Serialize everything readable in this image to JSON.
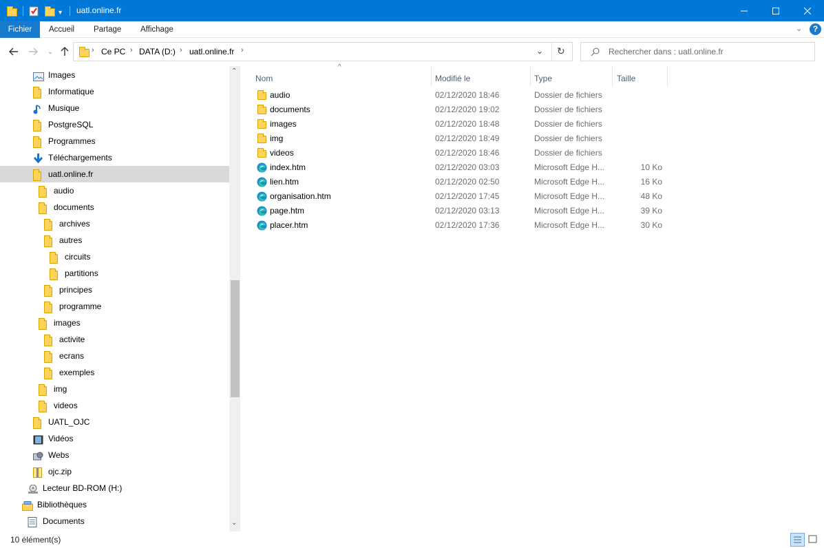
{
  "window": {
    "title": "uatl.online.fr"
  },
  "ribbon": {
    "tabs": [
      "Fichier",
      "Accueil",
      "Partage",
      "Affichage"
    ]
  },
  "address": {
    "crumbs": [
      "Ce PC",
      "DATA (D:)",
      "uatl.online.fr"
    ],
    "search_placeholder": "Rechercher dans : uatl.online.fr"
  },
  "nav": {
    "items": [
      {
        "label": "Images",
        "icon": "pictures-icon",
        "indent": 0
      },
      {
        "label": "Informatique",
        "icon": "folder-icon",
        "indent": 0
      },
      {
        "label": "Musique",
        "icon": "music-icon",
        "indent": 0
      },
      {
        "label": "PostgreSQL",
        "icon": "folder-icon",
        "indent": 0
      },
      {
        "label": "Programmes",
        "icon": "folder-icon",
        "indent": 0
      },
      {
        "label": "Téléchargements",
        "icon": "download-icon",
        "indent": 0
      },
      {
        "label": "uatl.online.fr",
        "icon": "folder-icon",
        "indent": 0,
        "selected": true
      },
      {
        "label": "audio",
        "icon": "folder-icon",
        "indent": 1
      },
      {
        "label": "documents",
        "icon": "folder-icon",
        "indent": 1
      },
      {
        "label": "archives",
        "icon": "folder-icon",
        "indent": 2
      },
      {
        "label": "autres",
        "icon": "folder-icon",
        "indent": 2
      },
      {
        "label": "circuits",
        "icon": "folder-icon",
        "indent": 3
      },
      {
        "label": "partitions",
        "icon": "folder-icon",
        "indent": 3
      },
      {
        "label": "principes",
        "icon": "folder-icon",
        "indent": 2
      },
      {
        "label": "programme",
        "icon": "folder-icon",
        "indent": 2
      },
      {
        "label": "images",
        "icon": "folder-icon",
        "indent": 1
      },
      {
        "label": "activite",
        "icon": "folder-icon",
        "indent": 2
      },
      {
        "label": "ecrans",
        "icon": "folder-icon",
        "indent": 2
      },
      {
        "label": "exemples",
        "icon": "folder-icon",
        "indent": 2
      },
      {
        "label": "img",
        "icon": "folder-icon",
        "indent": 1
      },
      {
        "label": "videos",
        "icon": "folder-icon",
        "indent": 1
      },
      {
        "label": "UATL_OJC",
        "icon": "folder-icon",
        "indent": 0
      },
      {
        "label": "Vidéos",
        "icon": "video-icon",
        "indent": 0
      },
      {
        "label": "Webs",
        "icon": "webs-icon",
        "indent": 0
      },
      {
        "label": "ojc.zip",
        "icon": "zip-icon",
        "indent": 0
      },
      {
        "label": "Lecteur BD-ROM (H:)",
        "icon": "disc-drive-icon",
        "indent": -1
      },
      {
        "label": "Bibliothèques",
        "icon": "libraries-icon",
        "indent": -2
      },
      {
        "label": "Documents",
        "icon": "documents-icon",
        "indent": -1
      }
    ]
  },
  "columns": {
    "name": "Nom",
    "modified": "Modifié le",
    "type": "Type",
    "size": "Taille"
  },
  "files": [
    {
      "name": "audio",
      "modified": "02/12/2020 18:46",
      "type": "Dossier de fichiers",
      "size": "",
      "icon": "folder-icon"
    },
    {
      "name": "documents",
      "modified": "02/12/2020 19:02",
      "type": "Dossier de fichiers",
      "size": "",
      "icon": "folder-icon"
    },
    {
      "name": "images",
      "modified": "02/12/2020 18:48",
      "type": "Dossier de fichiers",
      "size": "",
      "icon": "folder-icon"
    },
    {
      "name": "img",
      "modified": "02/12/2020 18:49",
      "type": "Dossier de fichiers",
      "size": "",
      "icon": "folder-icon"
    },
    {
      "name": "videos",
      "modified": "02/12/2020 18:46",
      "type": "Dossier de fichiers",
      "size": "",
      "icon": "folder-icon"
    },
    {
      "name": "index.htm",
      "modified": "02/12/2020 03:03",
      "type": "Microsoft Edge H...",
      "size": "10 Ko",
      "icon": "edge-icon"
    },
    {
      "name": "lien.htm",
      "modified": "02/12/2020 02:50",
      "type": "Microsoft Edge H...",
      "size": "16 Ko",
      "icon": "edge-icon"
    },
    {
      "name": "organisation.htm",
      "modified": "02/12/2020 17:45",
      "type": "Microsoft Edge H...",
      "size": "48 Ko",
      "icon": "edge-icon"
    },
    {
      "name": "page.htm",
      "modified": "02/12/2020 03:13",
      "type": "Microsoft Edge H...",
      "size": "39 Ko",
      "icon": "edge-icon"
    },
    {
      "name": "placer.htm",
      "modified": "02/12/2020 17:36",
      "type": "Microsoft Edge H...",
      "size": "30 Ko",
      "icon": "edge-icon"
    }
  ],
  "status": {
    "count": "10 élément(s)"
  },
  "colors": {
    "titlebar": "#0078d7",
    "file_tab": "#1979ca",
    "folder": "#ffd35c",
    "selected": "#d9d9d9"
  }
}
